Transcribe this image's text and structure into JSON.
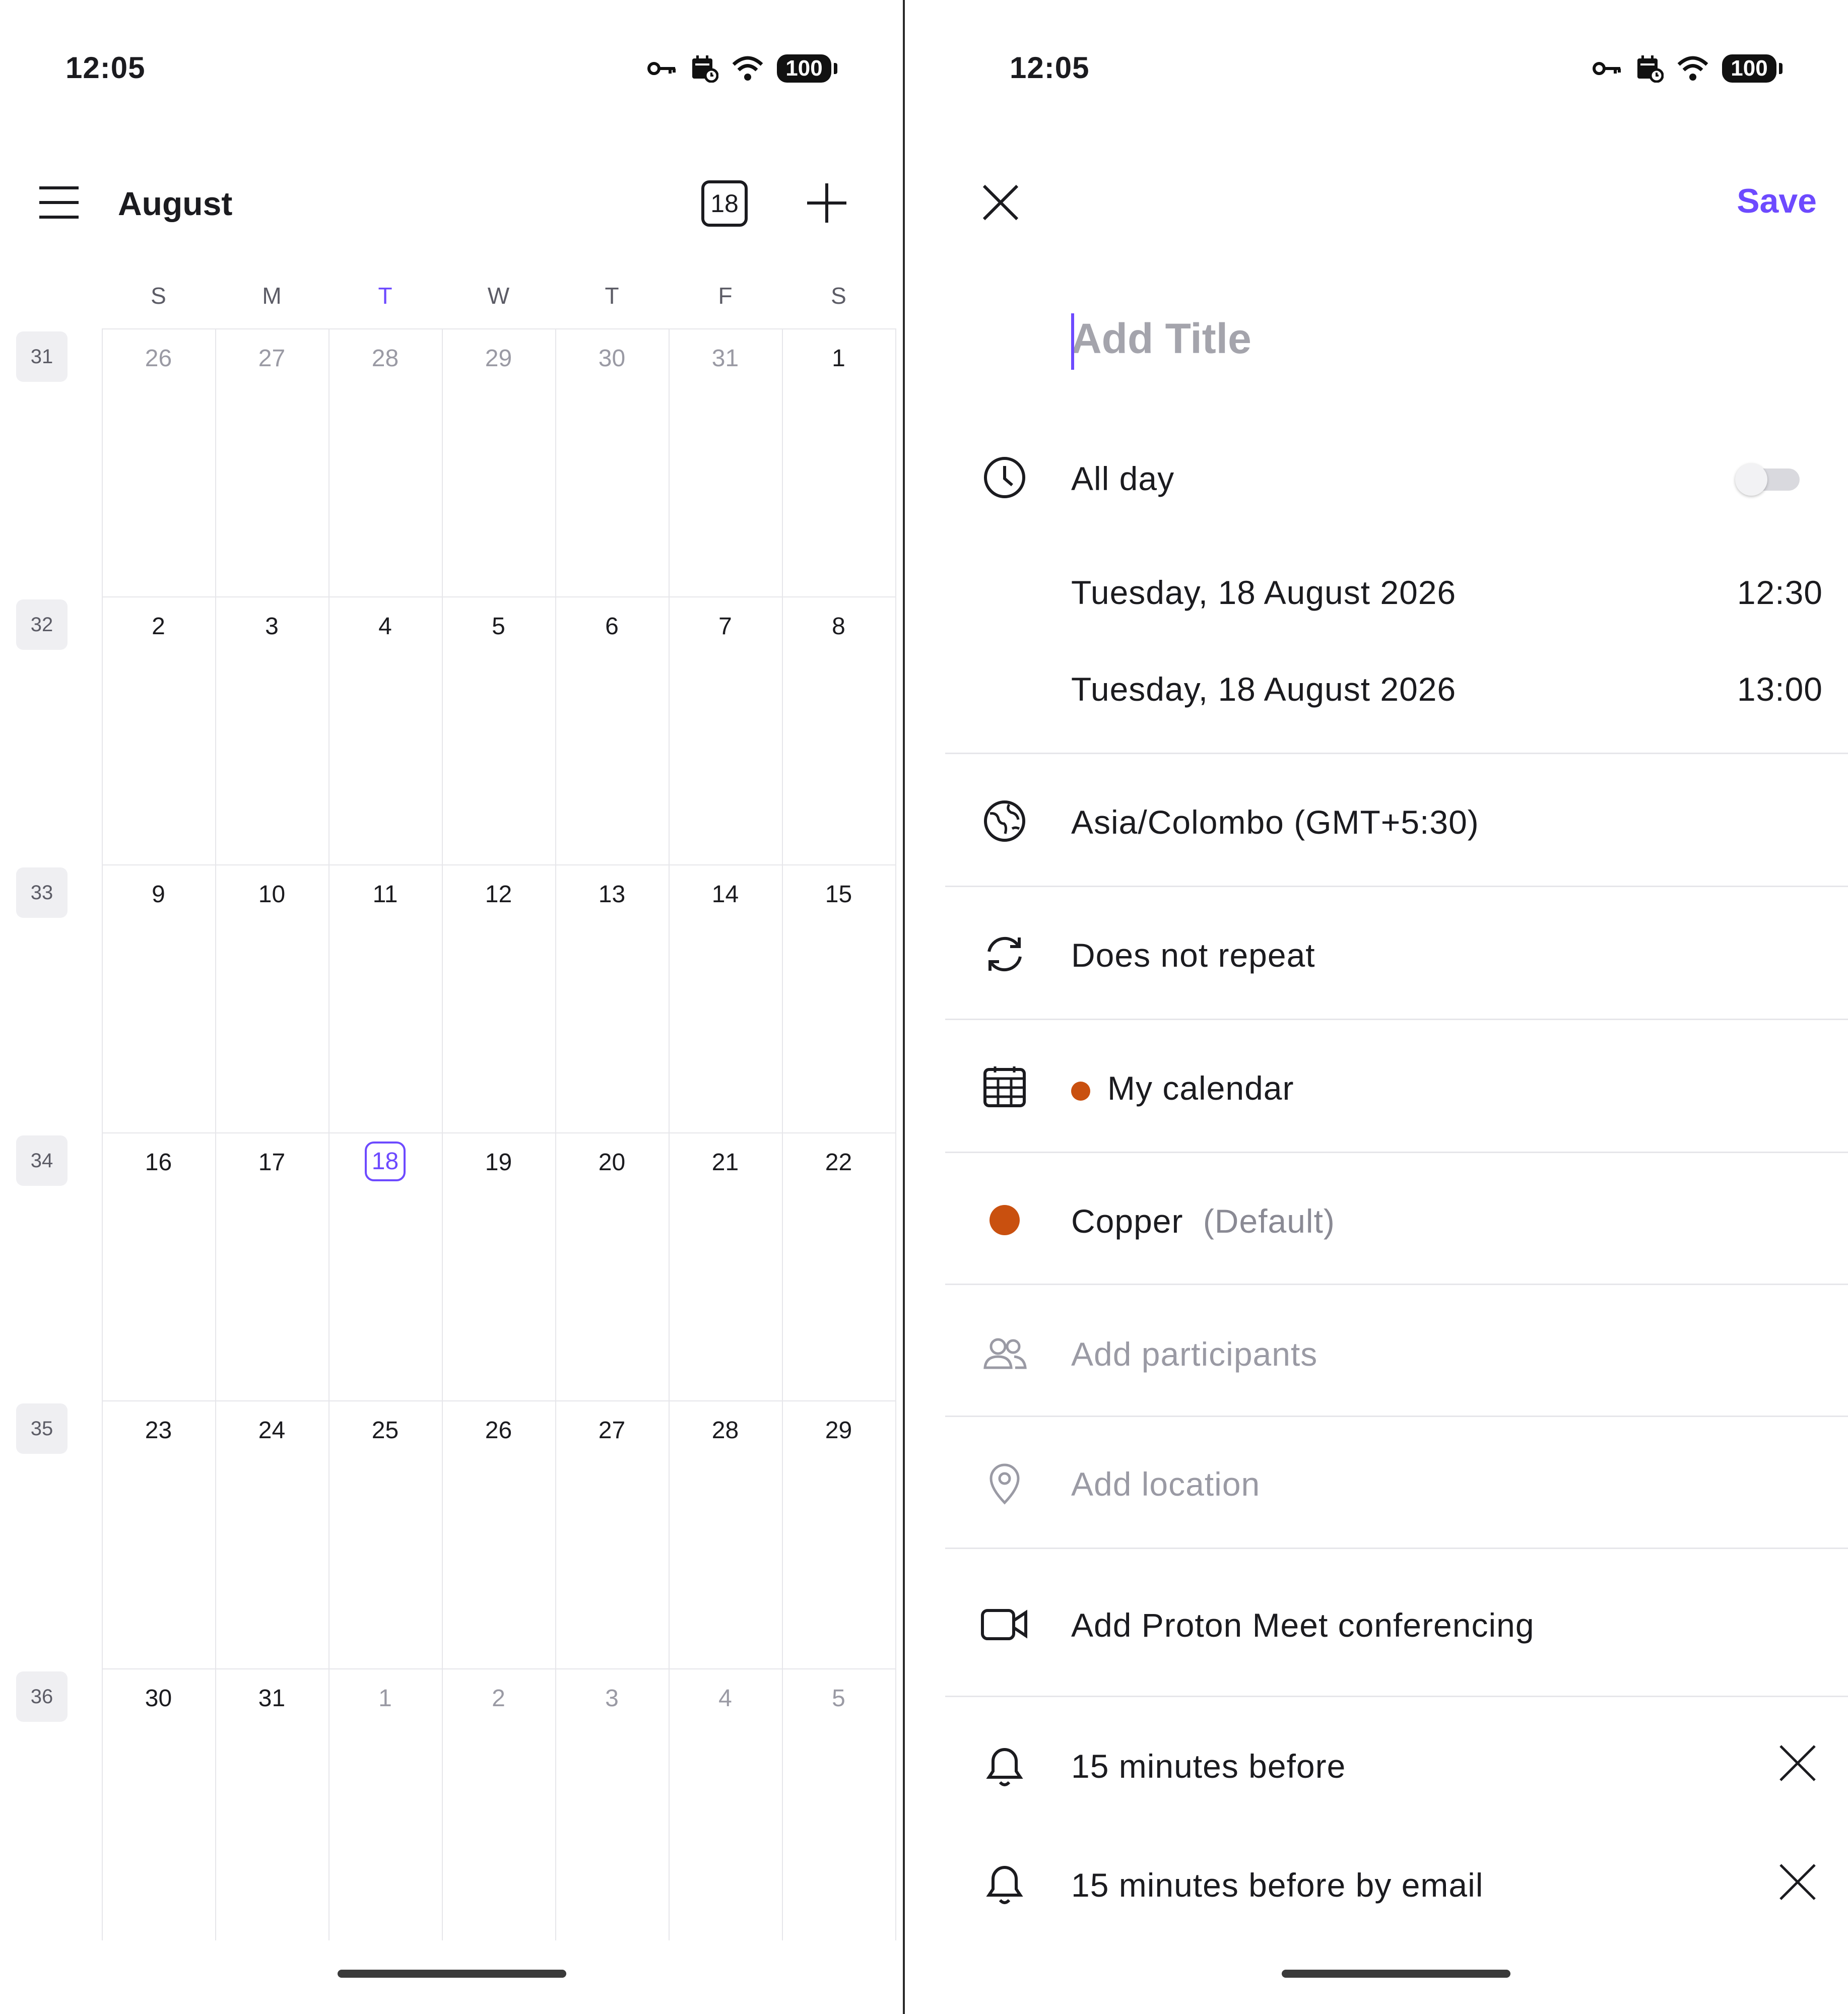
{
  "status_bar": {
    "time": "12:05",
    "battery": "100"
  },
  "left": {
    "month": "August",
    "today_button": "18",
    "weekdays": [
      "S",
      "M",
      "T",
      "W",
      "T",
      "F",
      "S"
    ],
    "today_weekday_index": 2,
    "weeks": [
      {
        "number": "31",
        "days": [
          "26",
          "27",
          "28",
          "29",
          "30",
          "31",
          "1"
        ],
        "muted": [
          true,
          true,
          true,
          true,
          true,
          true,
          false
        ]
      },
      {
        "number": "32",
        "days": [
          "2",
          "3",
          "4",
          "5",
          "6",
          "7",
          "8"
        ],
        "muted": [
          false,
          false,
          false,
          false,
          false,
          false,
          false
        ]
      },
      {
        "number": "33",
        "days": [
          "9",
          "10",
          "11",
          "12",
          "13",
          "14",
          "15"
        ],
        "muted": [
          false,
          false,
          false,
          false,
          false,
          false,
          false
        ]
      },
      {
        "number": "34",
        "days": [
          "16",
          "17",
          "18",
          "19",
          "20",
          "21",
          "22"
        ],
        "muted": [
          false,
          false,
          false,
          false,
          false,
          false,
          false
        ],
        "selected_index": 2
      },
      {
        "number": "35",
        "days": [
          "23",
          "24",
          "25",
          "26",
          "27",
          "28",
          "29"
        ],
        "muted": [
          false,
          false,
          false,
          false,
          false,
          false,
          false
        ]
      },
      {
        "number": "36",
        "days": [
          "30",
          "31",
          "1",
          "2",
          "3",
          "4",
          "5"
        ],
        "muted": [
          false,
          false,
          true,
          true,
          true,
          true,
          true
        ]
      }
    ]
  },
  "right": {
    "save_label": "Save",
    "title_placeholder": "Add Title",
    "all_day_label": "All day",
    "all_day_on": false,
    "start_date": "Tuesday, 18 August 2026",
    "start_time": "12:30",
    "end_date": "Tuesday, 18 August 2026",
    "end_time": "13:00",
    "timezone": "Asia/Colombo (GMT+5:30)",
    "repeat": "Does not repeat",
    "calendar_name": "My calendar",
    "color_name": "Copper",
    "color_default_tag": "(Default)",
    "participants_placeholder": "Add participants",
    "location_placeholder": "Add location",
    "conferencing": "Add Proton Meet conferencing",
    "notifications": [
      "15 minutes before",
      "15 minutes before by email"
    ]
  },
  "colors": {
    "accent": "#6d4aff",
    "copper": "#c9500f"
  }
}
